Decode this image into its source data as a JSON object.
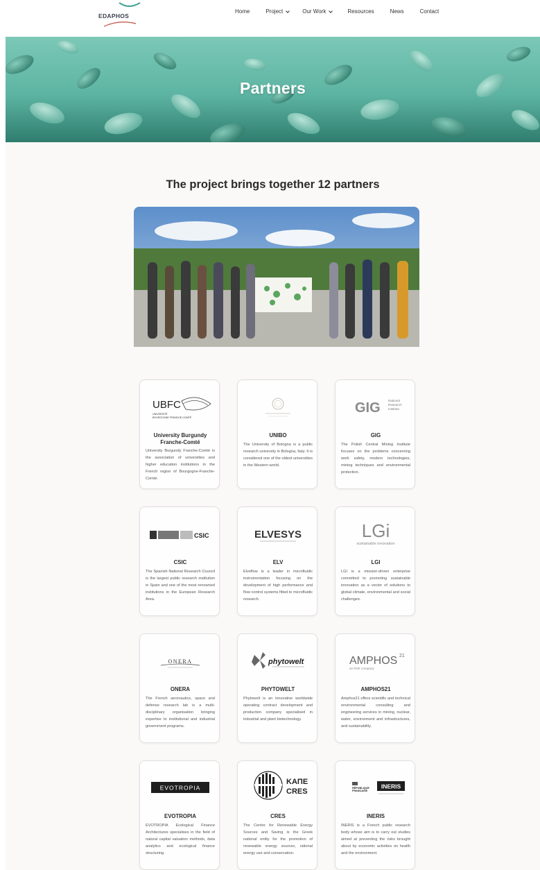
{
  "header": {
    "logo_text": "EDAPHOS",
    "nav": [
      {
        "label": "Home",
        "dropdown": false
      },
      {
        "label": "Project",
        "dropdown": true
      },
      {
        "label": "Our Work",
        "dropdown": true
      },
      {
        "label": "Resources",
        "dropdown": false
      },
      {
        "label": "News",
        "dropdown": false
      },
      {
        "label": "Contact",
        "dropdown": false
      }
    ]
  },
  "banner": {
    "title": "Partners",
    "color": "#5fb8a6"
  },
  "intro": {
    "heading": "The project brings together 12 partners"
  },
  "partners": [
    {
      "name": "University Burgundy Franche-Comté",
      "logo": "UBFC",
      "logo_sub": "UNIVERSITÉ BOURGOGNE FRANCHE-COMTÉ",
      "desc": "University Burgundy Franche-Comté is the association of universities and higher education institutions in the French region of Bourgogne-Franche-Comté."
    },
    {
      "name": "UNIBO",
      "logo": "",
      "logo_sub": "",
      "desc": "The University of Bologna is a public research university in Bologna, Italy. It is considered one of the oldest universities in the Western world."
    },
    {
      "name": "GIG",
      "logo": "GIG",
      "logo_sub": "National Research Institute",
      "desc": "The Polish Central Mining Institute focuses on the problems concerning work safety, modern technologies, mining techniques and environmental protection."
    },
    {
      "name": "CSIC",
      "logo": "CSIC",
      "logo_sub": "",
      "desc": "The Spanish National Research Council is the largest public research institution in Spain and one of the most renowned institutions in the European Research Area."
    },
    {
      "name": "ELV",
      "logo": "ELVESYS",
      "logo_sub": "",
      "desc": "Elveflow is a leader in microfluidic instrumentation focusing on the development of high performance and flow control systems fitted to microfluidic research."
    },
    {
      "name": "LGI",
      "logo": "LGi",
      "logo_sub": "sustainable innovation",
      "desc": "LGI is a mission-driven enterprise committed to promoting sustainable innovation as a vector of solutions to global climate, environmental and social challenges."
    },
    {
      "name": "ONERA",
      "logo": "ONERA",
      "logo_sub": "",
      "desc": "The French aeronautics, space and defense research lab is a multi-disciplinary organisation bringing expertise to institutional and industrial government programs."
    },
    {
      "name": "PHYTOWELT",
      "logo": "phytowelt",
      "logo_sub": "",
      "desc": "Phytowelt is an innovative worldwide operating contract development and production company specialised in industrial and plant biotechnology."
    },
    {
      "name": "AMPHOS21",
      "logo": "AMPHOS",
      "logo_sup": "21",
      "logo_sub": "an RSK company",
      "desc": "Amphos21 offers scientific and technical environmental consulting and engineering services in mining, nuclear, water, environment and infrastructures, and sustainability."
    },
    {
      "name": "EVOTROPIA",
      "logo": "EVOTROPIA",
      "logo_sub": "",
      "desc": "EVOTROPIA Ecological Finance Architectures specialises in the field of natural capital valuation methods, data analytics and ecological finance structuring."
    },
    {
      "name": "CRES",
      "logo": "ΚΑΠΕ",
      "logo_sub": "CRES",
      "desc": "The Centre for Renewable Energy Sources and Saving is the Greek national entity for the promotion of renewable energy sources, rational energy use and conservation."
    },
    {
      "name": "INERIS",
      "logo": "INERIS",
      "logo_sub": "RÉPUBLIQUE FRANÇAISE",
      "desc": "INERIS is a French public research body whose aim is to carry out studies aimed at preventing the risks brought about by economic activities on health and the environment."
    }
  ]
}
